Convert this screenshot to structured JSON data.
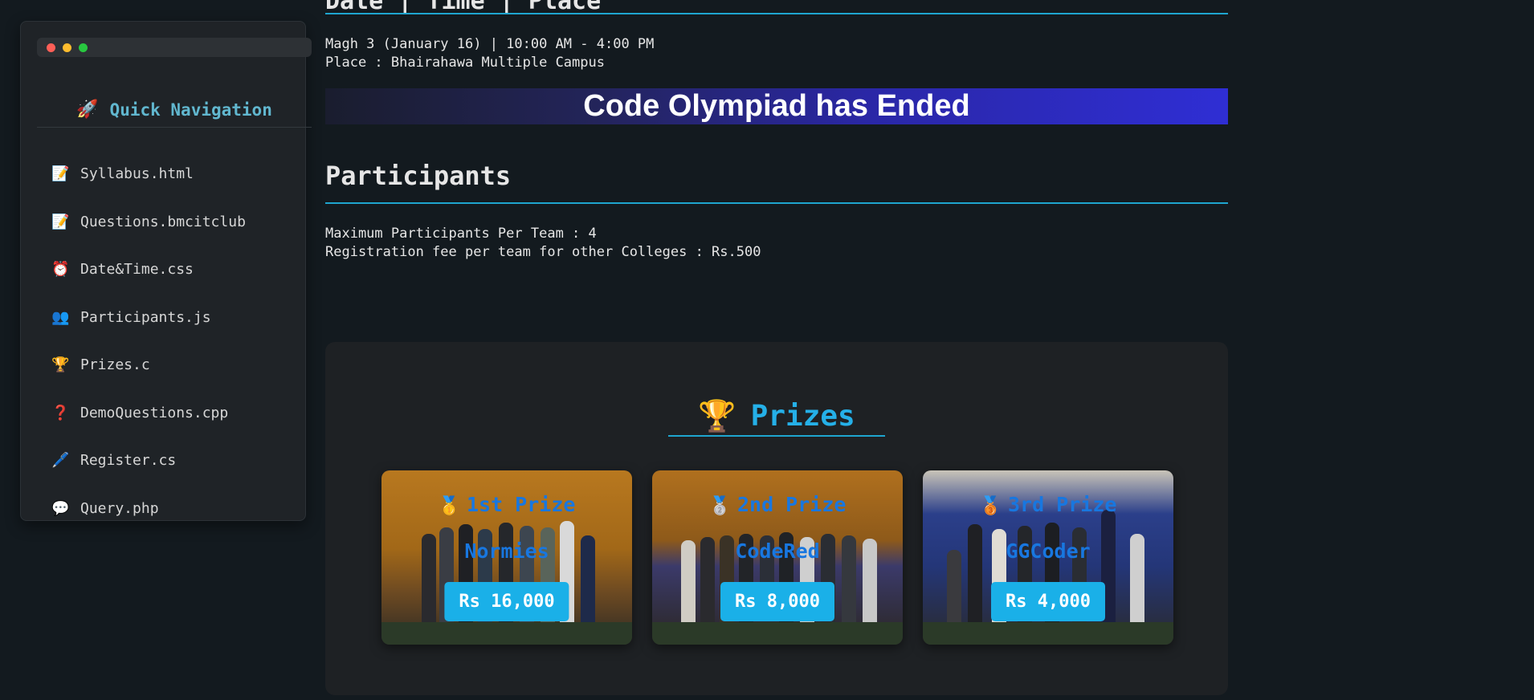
{
  "sidebar": {
    "title": "Quick Navigation",
    "title_icon": "rocket-icon",
    "window_dots": [
      "#ff5f57",
      "#febc2e",
      "#28c840"
    ],
    "items": [
      {
        "label": "Syllabus.html",
        "icon": "memo-icon",
        "glyph": "📝"
      },
      {
        "label": "Questions.bmcitclub",
        "icon": "memo-icon",
        "glyph": "📝"
      },
      {
        "label": "Date&Time.css",
        "icon": "alarm-clock-icon",
        "glyph": "⏰"
      },
      {
        "label": "Participants.js",
        "icon": "people-icon",
        "glyph": "👥"
      },
      {
        "label": "Prizes.c",
        "icon": "trophy-icon",
        "glyph": "🏆"
      },
      {
        "label": "DemoQuestions.cpp",
        "icon": "question-mark-icon",
        "glyph": "❓"
      },
      {
        "label": "Register.cs",
        "icon": "pen-icon",
        "glyph": "🖊️"
      },
      {
        "label": "Query.php",
        "icon": "speech-bubble-icon",
        "glyph": "💬"
      }
    ]
  },
  "main": {
    "date_heading": "Date | Time | Place",
    "date_line": "Magh 3 (January 16) | 10:00 AM - 4:00 PM",
    "place_line": "Place : Bhairahawa Multiple Campus",
    "banner": "Code Olympiad has Ended",
    "participants_heading": "Participants",
    "max_participants": "Maximum Participants Per Team : 4",
    "registration_fee": "Registration fee per team for other Colleges : Rs.500"
  },
  "prizes": {
    "title": "Prizes",
    "title_icon": "trophy-icon",
    "cards": [
      {
        "place": "1st Prize",
        "medal": "first-place-medal-icon",
        "team": "Normies",
        "amount": "Rs 16,000"
      },
      {
        "place": "2nd Prize",
        "medal": "second-place-medal-icon",
        "team": "CodeRed",
        "amount": "Rs 8,000"
      },
      {
        "place": "3rd Prize",
        "medal": "third-place-medal-icon",
        "team": "GGCoder",
        "amount": "Rs 4,000"
      }
    ]
  },
  "colors": {
    "accent": "#1ea5cf",
    "sidebar_title": "#61b7cf",
    "prize_text": "#1877e0",
    "amount_bg": "#1ab0e8"
  }
}
